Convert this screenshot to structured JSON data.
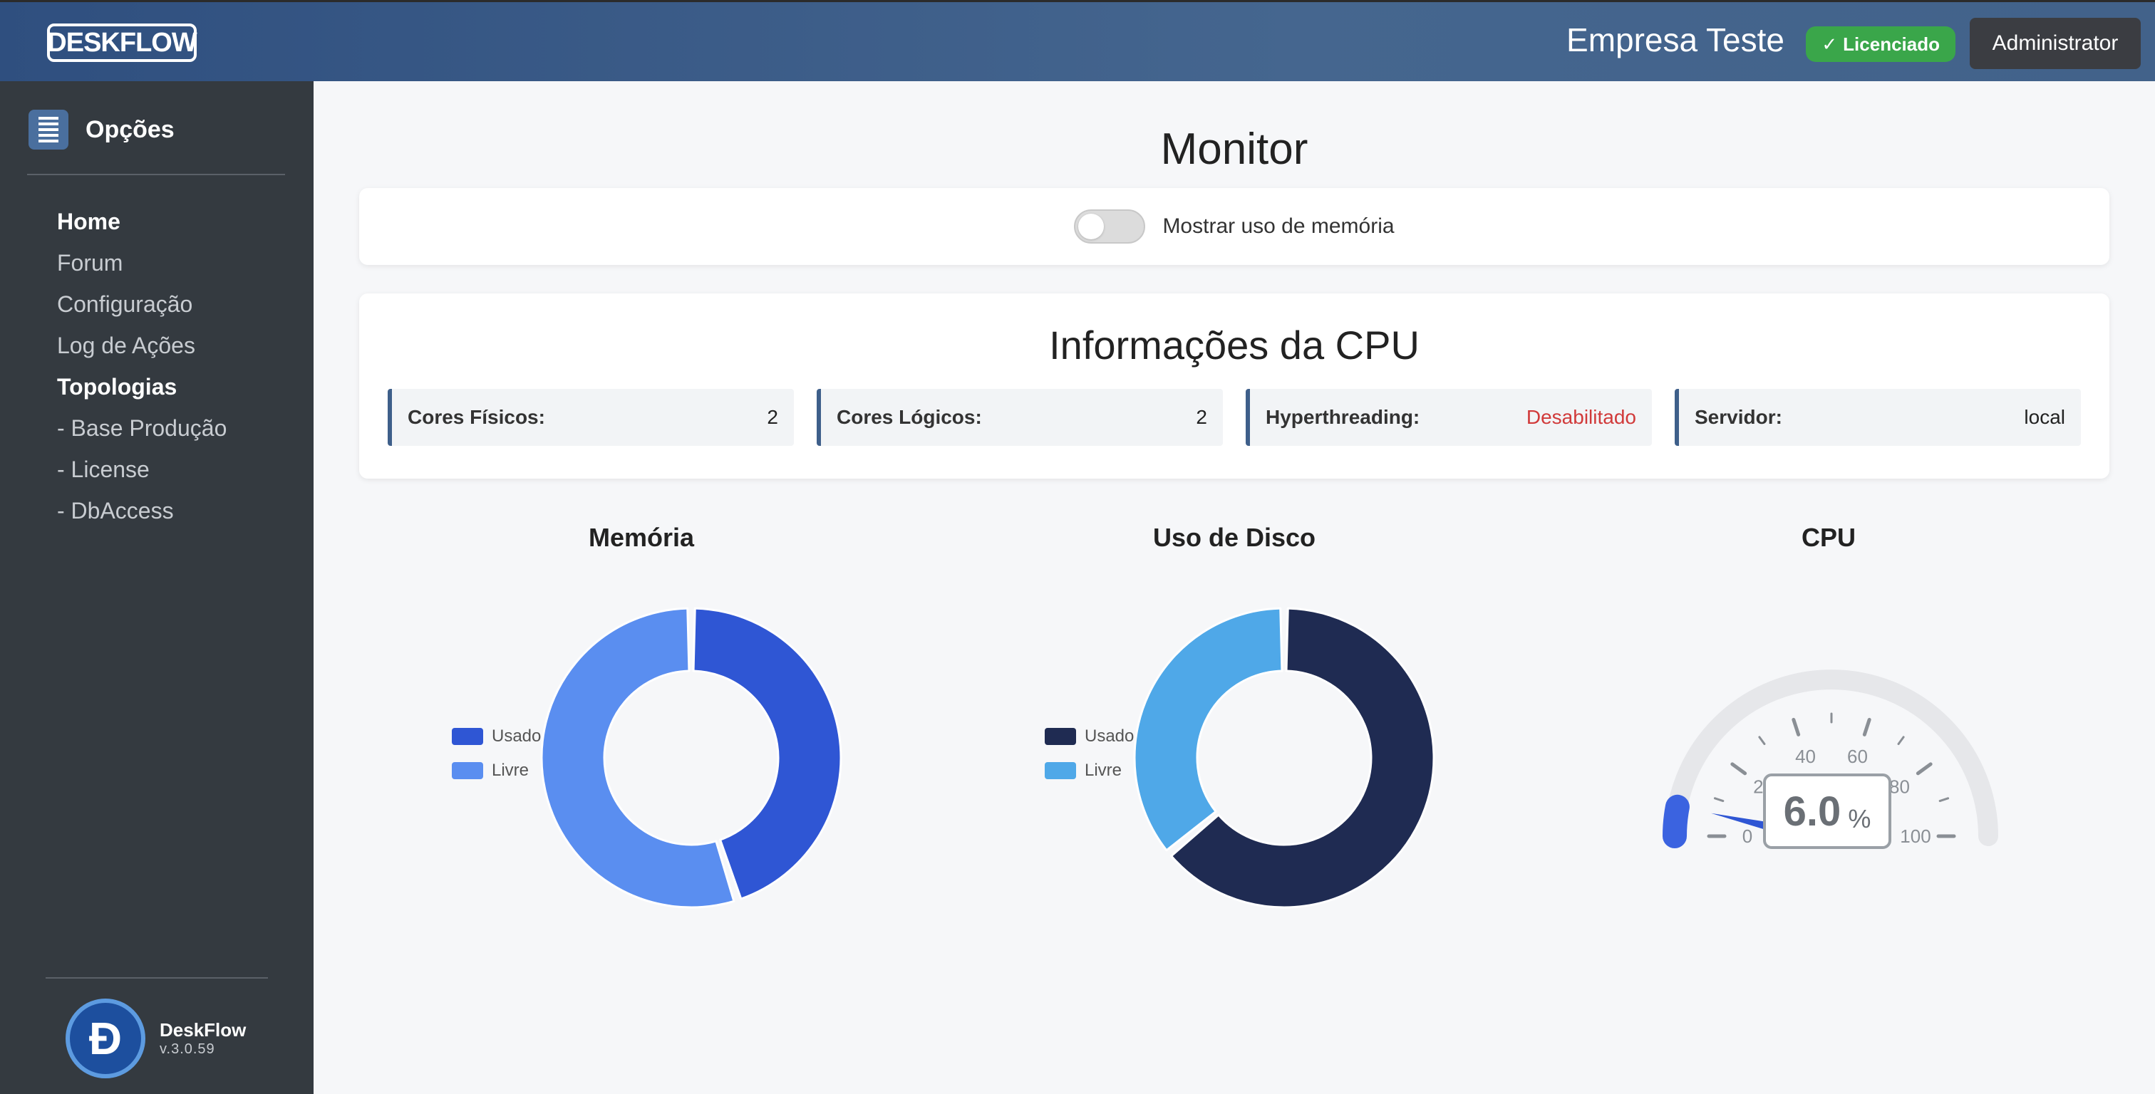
{
  "header": {
    "logo_text": "DESKFLOW",
    "company": "Empresa Teste",
    "license_badge": "Licenciado",
    "admin_button": "Administrator"
  },
  "sidebar": {
    "title": "Opções",
    "items": [
      {
        "label": "Home",
        "active": true
      },
      {
        "label": "Forum",
        "active": false
      },
      {
        "label": "Configuração",
        "active": false
      },
      {
        "label": "Log de Ações",
        "active": false
      },
      {
        "label": "Topologias",
        "active": true
      },
      {
        "label": "- Base Produção",
        "active": false
      },
      {
        "label": "- License",
        "active": false
      },
      {
        "label": "- DbAccess",
        "active": false
      }
    ],
    "brand_name": "DeskFlow",
    "brand_version": "v.3.0.59"
  },
  "main": {
    "title": "Monitor",
    "toggle_label": "Mostrar uso de memória",
    "cpu_info": {
      "title": "Informações da CPU",
      "items": [
        {
          "label": "Cores Físicos:",
          "value": "2"
        },
        {
          "label": "Cores Lógicos:",
          "value": "2"
        },
        {
          "label": "Hyperthreading:",
          "value": "Desabilitado"
        },
        {
          "label": "Servidor:",
          "value": "local"
        }
      ]
    }
  },
  "colors": {
    "mem_used": "#2f56d4",
    "mem_free": "#5a8ef0",
    "disk_used": "#1f2b52",
    "disk_free": "#4fa8e8",
    "danger": "#d13a3a"
  },
  "chart_data": [
    {
      "type": "pie",
      "title": "Memória",
      "categories": [
        "Usado",
        "Livre"
      ],
      "values": [
        45,
        55
      ],
      "legend": "left"
    },
    {
      "type": "pie",
      "title": "Uso de Disco",
      "categories": [
        "Usado",
        "Livre"
      ],
      "values": [
        64,
        36
      ],
      "legend": "left"
    },
    {
      "type": "gauge",
      "title": "CPU",
      "value": 6.0,
      "value_label": "6.0",
      "unit": "%",
      "min": 0,
      "max": 100,
      "tick_labels": [
        "0",
        "20",
        "40",
        "60",
        "80",
        "100"
      ]
    }
  ]
}
